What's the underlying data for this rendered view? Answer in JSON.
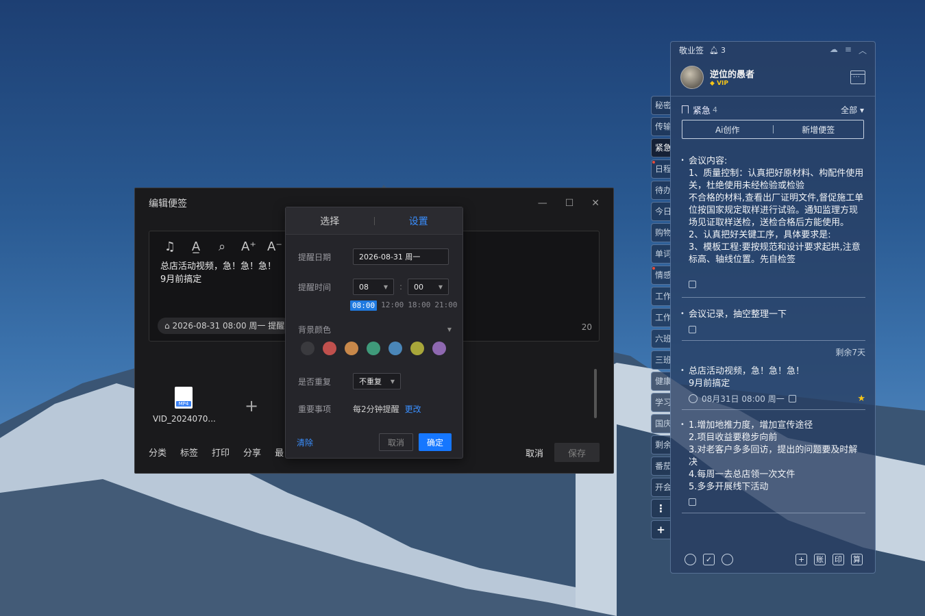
{
  "note_app": {
    "title": "敬业签",
    "bell_count": "3",
    "user": {
      "name": "逆位的愚者",
      "badge": "VIP"
    },
    "category": {
      "name": "紧急",
      "count": "4",
      "filter": "全部 ▾"
    },
    "actions": {
      "ai": "Ai创作",
      "new": "新增便签"
    },
    "notes": [
      {
        "text": "会议内容:\n1、质量控制：认真把好原材料、构配件使用关，杜绝使用未经检验或检验\n不合格的材料,查看出厂证明文件,督促施工单位按国家规定取样进行试验。通知监理方现场见证取样送检，送检合格后方能使用。\n2、认真把好关键工序，具体要求是:\n3、模板工程:要按规范和设计要求起拱,注意标高、轴线位置。先自检签"
      },
      {
        "text": "会议记录，抽空整理一下"
      },
      {
        "text": "总店活动视频，急！急！急！\n9月前搞定",
        "remain": "剩余7天",
        "time": "08月31日 08:00 周一"
      },
      {
        "text": "1.增加地推力度，增加宣传途径\n2.项目收益要稳步向前\n3.对老客户多多回访，提出的问题要及时解决\n4.每周一去总店领一次文件\n5.多多开展线下活动"
      }
    ],
    "bottom_icons": [
      "clock-icon",
      "check-icon",
      "search-icon",
      "add-icon",
      "ledger-icon",
      "print-icon",
      "calc-icon"
    ],
    "bottom_labels": {
      "add": "+",
      "ledger": "账",
      "print": "印",
      "calc": "算"
    }
  },
  "side_tabs": [
    "秘密",
    "传输",
    "紧急",
    "日程",
    "待办",
    "今日",
    "购物",
    "单词",
    "情感",
    "工作",
    "工作",
    "六班",
    "三班",
    "健康",
    "学习",
    "国庆",
    "剩余",
    "番茄",
    "开会"
  ],
  "side_buttons": {
    "more": "⋮",
    "add": "+"
  },
  "edit_dialog": {
    "title": "编辑便签",
    "body": "总店活动视频，急！急！急！\n9月前搞定",
    "reminder_chip": "2026-08-31 08:00 周一 提醒",
    "char_count": "20",
    "attachment_name": "VID_2024070...",
    "attachment_badge": "MP4",
    "footer": [
      "分类",
      "标签",
      "打印",
      "分享",
      "最"
    ],
    "cancel": "取消",
    "save": "保存"
  },
  "reminder_popover": {
    "tabs": [
      "选择",
      "设置"
    ],
    "date_label": "提醒日期",
    "date_value": "2026-08-31 周一",
    "time_label": "提醒时间",
    "hour": "08",
    "minute": "00",
    "quick_times": [
      "08:00",
      "12:00",
      "18:00",
      "21:00"
    ],
    "bg_label": "背景颜色",
    "bg_colors": [
      "#3a3a3e",
      "#c0504d",
      "#c8884a",
      "#3f9a7a",
      "#4a86b8",
      "#a8a63a",
      "#8e68b0"
    ],
    "repeat_label": "是否重复",
    "repeat_value": "不重复",
    "important_label": "重要事项",
    "important_value": "每2分钟提醒",
    "change": "更改",
    "clear": "清除",
    "cancel": "取消",
    "ok": "确定"
  }
}
